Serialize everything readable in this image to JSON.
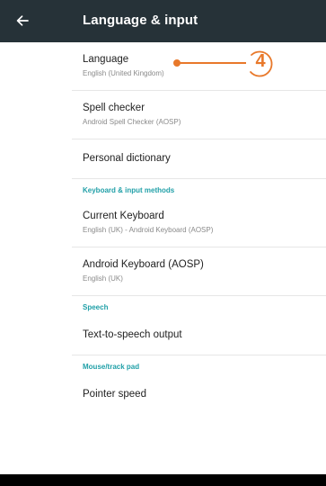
{
  "appbar": {
    "title": "Language & input",
    "back_icon": "arrow-back-icon",
    "background": "#263238"
  },
  "items": {
    "language": {
      "title": "Language",
      "summary": "English (United Kingdom)"
    },
    "spell_checker": {
      "title": "Spell checker",
      "summary": "Android Spell Checker (AOSP)"
    },
    "personal_dictionary": {
      "title": "Personal dictionary"
    },
    "current_keyboard": {
      "title": "Current Keyboard",
      "summary": "English (UK) - Android Keyboard (AOSP)"
    },
    "android_keyboard": {
      "title": "Android Keyboard (AOSP)",
      "summary": "English (UK)"
    },
    "tts_output": {
      "title": "Text-to-speech output"
    },
    "pointer_speed": {
      "title": "Pointer speed"
    }
  },
  "sections": {
    "keyboard": "Keyboard & input methods",
    "speech": "Speech",
    "mouse": "Mouse/track pad"
  },
  "callout": {
    "number": "4",
    "color": "#e8782a"
  },
  "colors": {
    "section_header": "#21a0a8",
    "divider": "#e6e6e6"
  }
}
